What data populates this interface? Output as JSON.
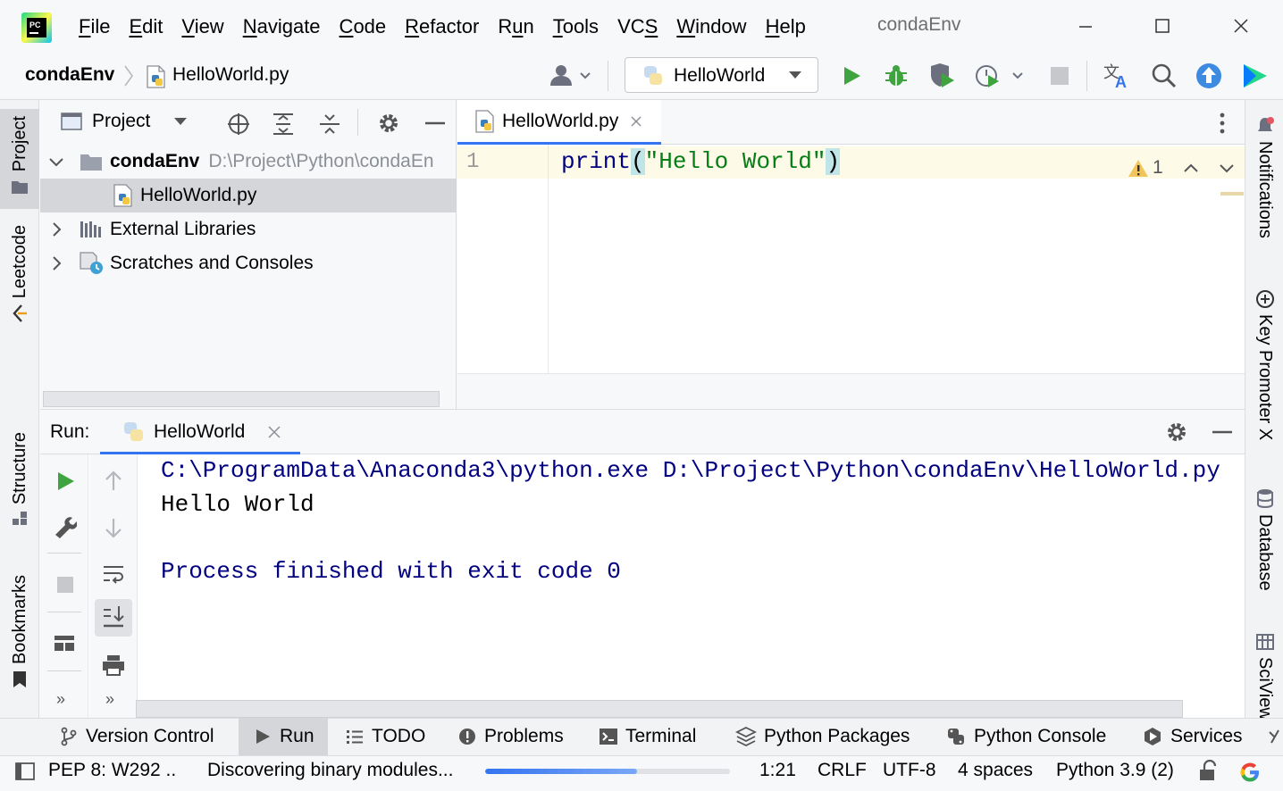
{
  "menubar": {
    "items": [
      "File",
      "Edit",
      "View",
      "Navigate",
      "Code",
      "Refactor",
      "Run",
      "Tools",
      "VCS",
      "Window",
      "Help"
    ],
    "mnemonics": [
      "F",
      "E",
      "V",
      "N",
      "C",
      "R",
      "u",
      "T",
      "S",
      "W",
      "H"
    ],
    "window_title": "condaEnv",
    "icons": [
      "pycharm-logo",
      "minimize-icon",
      "maximize-icon",
      "close-icon"
    ]
  },
  "navbar": {
    "project": "condaEnv",
    "file": "HelloWorld.py",
    "run_config": "HelloWorld",
    "icons": [
      "user-icon",
      "run-icon",
      "debug-icon",
      "coverage-icon",
      "profile-icon",
      "stop-icon",
      "translate-icon",
      "search-icon",
      "update-icon",
      "code-with-me-icon"
    ]
  },
  "left_strip": {
    "tabs": [
      "Project",
      "Leetcode",
      "Structure",
      "Bookmarks"
    ]
  },
  "right_strip": {
    "tabs": [
      "Notifications",
      "Key Promoter X",
      "Database",
      "SciView"
    ]
  },
  "project_panel": {
    "title": "Project",
    "tree": [
      {
        "label": "condaEnv",
        "path": "D:\\Project\\Python\\condaEn",
        "expanded": true
      },
      {
        "label": "HelloWorld.py",
        "selected": true
      },
      {
        "label": "External Libraries",
        "expanded": false
      },
      {
        "label": "Scratches and Consoles",
        "expanded": false
      }
    ]
  },
  "editor": {
    "tab_label": "HelloWorld.py",
    "line_number": "1",
    "code": {
      "fn": "print",
      "open": "(",
      "str": "\"Hello World\"",
      "close": ")"
    },
    "warning_count": "1"
  },
  "run_panel": {
    "title": "Run:",
    "tab_label": "HelloWorld",
    "console": [
      "C:\\ProgramData\\Anaconda3\\python.exe D:\\Project\\Python\\condaEnv\\HelloWorld.py",
      "Hello World",
      "",
      "Process finished with exit code 0"
    ]
  },
  "bottom_tools": [
    "Version Control",
    "Run",
    "TODO",
    "Problems",
    "Terminal",
    "Python Packages",
    "Python Console",
    "Services"
  ],
  "statusbar": {
    "inspection": "PEP 8: W292 ..",
    "task": "Discovering binary modules...",
    "progress": 0.62,
    "position": "1:21",
    "line_sep": "CRLF",
    "encoding": "UTF-8",
    "indent": "4 spaces",
    "interpreter": "Python 3.9 (2)"
  },
  "colors": {
    "accent": "#3574f0",
    "run_green": "#3fa33f",
    "keyword": "#000080",
    "string": "#067d17"
  }
}
